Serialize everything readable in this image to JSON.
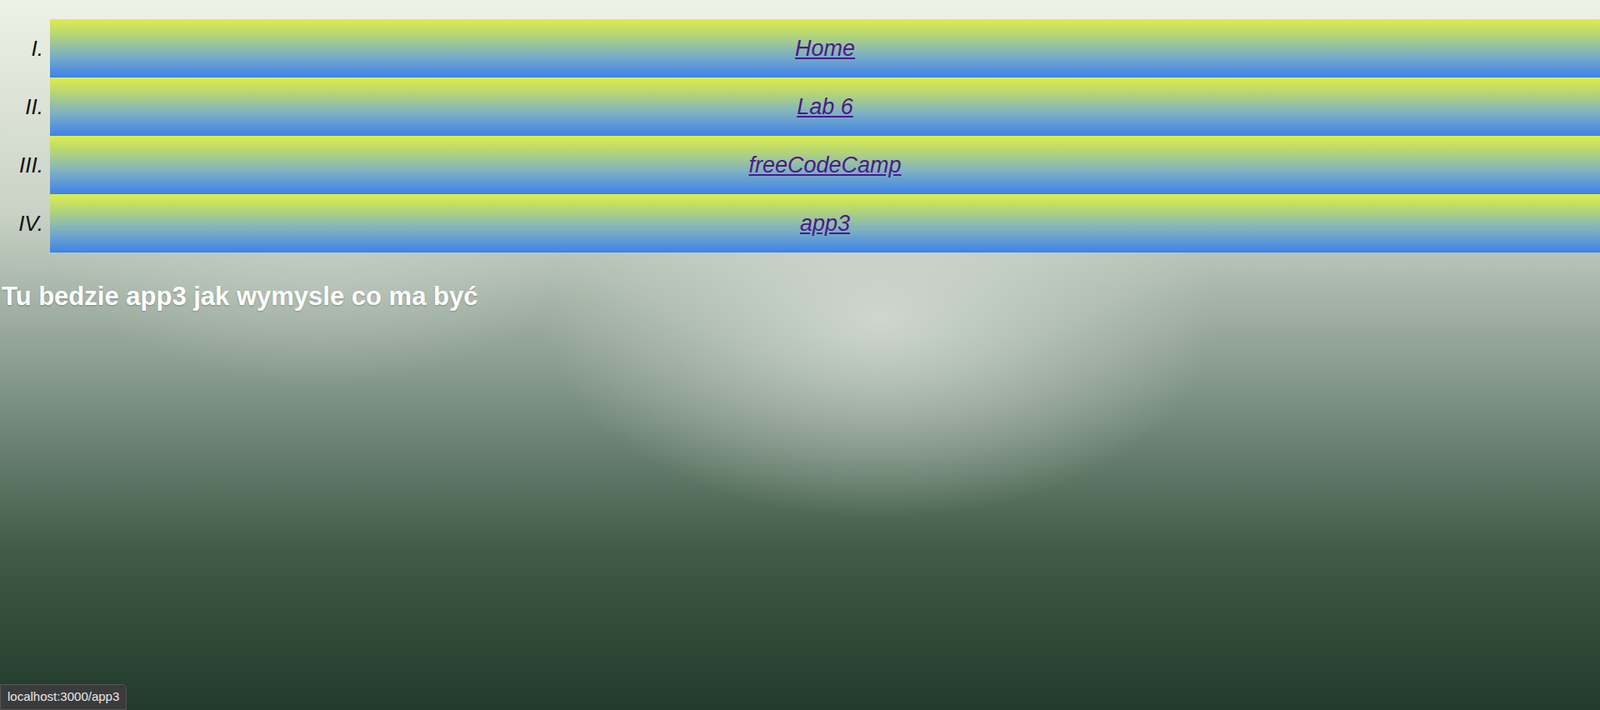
{
  "nav": {
    "items": [
      {
        "numeral": "I.",
        "label": "Home"
      },
      {
        "numeral": "II.",
        "label": "Lab 6"
      },
      {
        "numeral": "III.",
        "label": "freeCodeCamp"
      },
      {
        "numeral": "IV.",
        "label": "app3"
      }
    ]
  },
  "heading": "Tu bedzie app3 jak wymysle co ma być",
  "status_bar": "localhost:3000/app3"
}
